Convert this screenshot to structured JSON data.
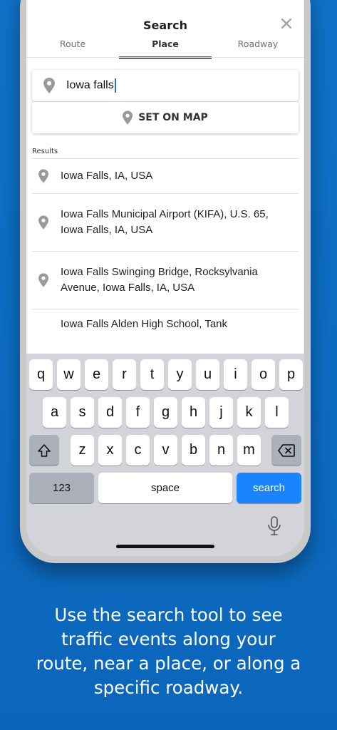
{
  "header": {
    "title": "Search",
    "close_icon": "close-icon"
  },
  "tabs": [
    {
      "label": "Route",
      "active": false
    },
    {
      "label": "Place",
      "active": true
    },
    {
      "label": "Roadway",
      "active": false
    }
  ],
  "search": {
    "value": "Iowa falls",
    "icon": "map-pin-icon"
  },
  "set_on_map": {
    "label": "SET ON MAP",
    "icon": "map-pin-icon"
  },
  "results": {
    "label": "Results",
    "items": [
      {
        "line1": "Iowa Falls, IA, USA",
        "line2": ""
      },
      {
        "line1": "Iowa Falls Municipal Airport (KIFA), U.S. 65,",
        "line2": "Iowa Falls, IA, USA"
      },
      {
        "line1": "Iowa Falls Swinging Bridge, Rocksylvania",
        "line2": "Avenue, Iowa Falls, IA, USA"
      },
      {
        "line1": "Iowa Falls Alden High School, Tank",
        "line2": ""
      }
    ]
  },
  "keyboard": {
    "row1": [
      "q",
      "w",
      "e",
      "r",
      "t",
      "y",
      "u",
      "i",
      "o",
      "p"
    ],
    "row2": [
      "a",
      "s",
      "d",
      "f",
      "g",
      "h",
      "j",
      "k",
      "l"
    ],
    "row3": [
      "z",
      "x",
      "c",
      "v",
      "b",
      "n",
      "m"
    ],
    "numbers_label": "123",
    "space_label": "space",
    "search_label": "search",
    "shift_icon": "shift-icon",
    "backspace_icon": "backspace-icon",
    "mic_icon": "microphone-icon"
  },
  "caption": {
    "line1": "Use the search tool to see",
    "line2": "traffic events along your",
    "line3": "route, near a place, or along a",
    "line4": "specific roadway."
  },
  "colors": {
    "background": "#0d6ec3",
    "accent": "#1a84ff",
    "keyboard": "#d2d4d9"
  }
}
